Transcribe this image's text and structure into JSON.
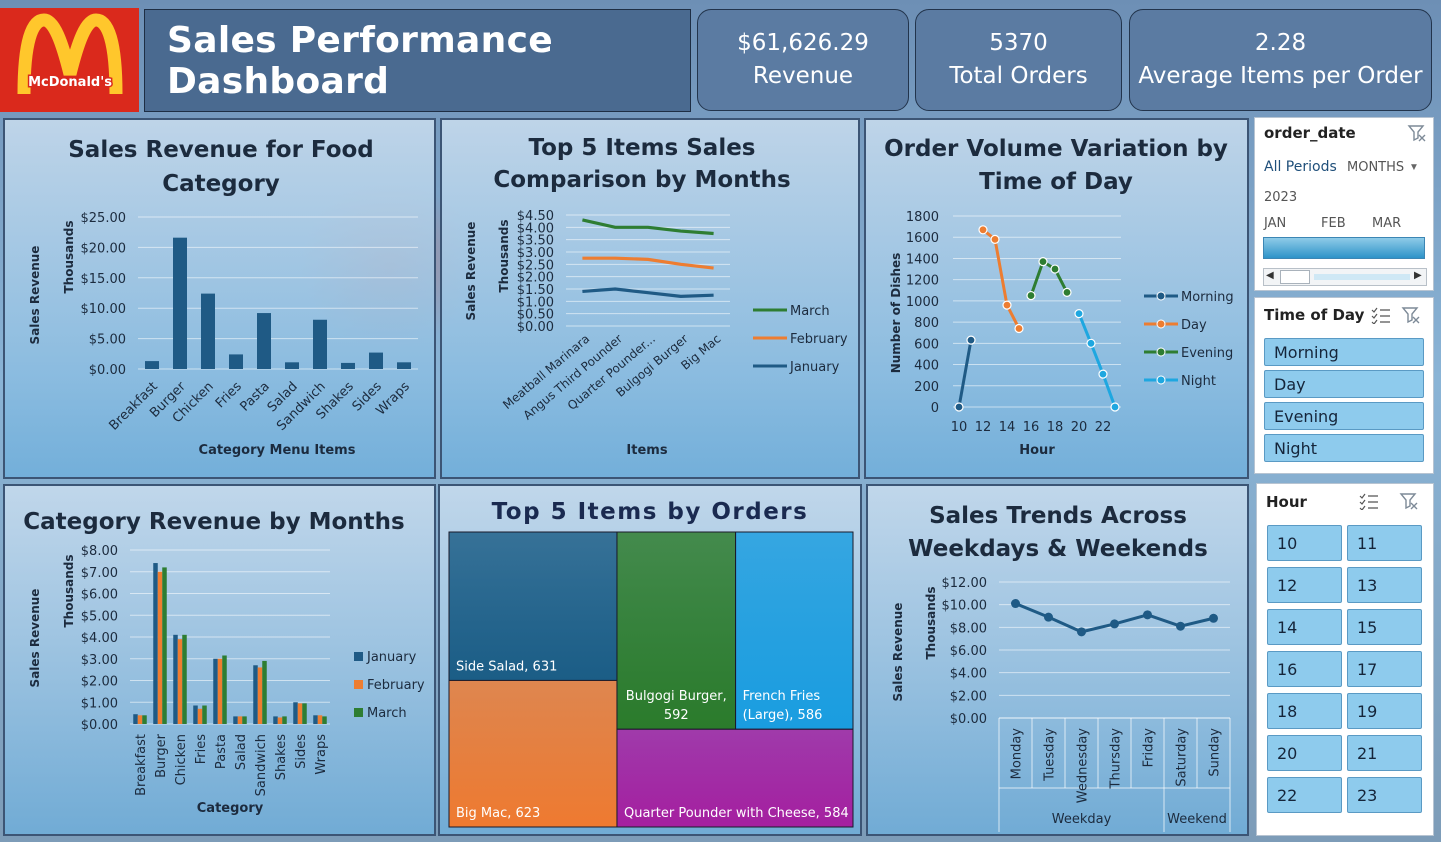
{
  "header": {
    "logo_text": "McDonald's",
    "title": "Sales Performance Dashboard",
    "kpis": [
      {
        "value": "$61,626.29",
        "label": "Revenue"
      },
      {
        "value": "5370",
        "label": "Total Orders"
      },
      {
        "value": "2.28",
        "label": "Average Items per Order"
      }
    ]
  },
  "colors": {
    "brand_red": "#da291c",
    "brand_yellow": "#ffc72c",
    "navy": "#1f5a85",
    "orange": "#ed7d31",
    "green": "#2e7d32",
    "light_blue": "#1ea7e0",
    "slicer_button": "#8ecbed"
  },
  "timeline": {
    "field": "order_date",
    "all_periods": "All Periods",
    "level": "MONTHS",
    "year": "2023",
    "months": [
      "JAN",
      "FEB",
      "MAR"
    ],
    "selected_months": [
      "JAN",
      "FEB",
      "MAR"
    ]
  },
  "time_of_day_slicer": {
    "title": "Time of Day",
    "items": [
      "Morning",
      "Day",
      "Evening",
      "Night"
    ]
  },
  "hour_slicer": {
    "title": "Hour",
    "items": [
      "10",
      "11",
      "12",
      "13",
      "14",
      "15",
      "16",
      "17",
      "18",
      "19",
      "20",
      "21",
      "22",
      "23"
    ]
  },
  "chart_data": [
    {
      "id": "category-revenue",
      "type": "bar",
      "title": "Sales Revenue for Food Category",
      "xlabel": "Category Menu Items",
      "ylabel": "Sales Revenue",
      "unit_label": "Thousands",
      "ylim": [
        0,
        25
      ],
      "yticks": [
        "$0.00",
        "$5.00",
        "$10.00",
        "$15.00",
        "$20.00",
        "$25.00"
      ],
      "categories": [
        "Breakfast",
        "Burger",
        "Chicken",
        "Fries",
        "Pasta",
        "Salad",
        "Sandwich",
        "Shakes",
        "Sides",
        "Wraps"
      ],
      "values": [
        1.3,
        21.6,
        12.4,
        2.4,
        9.2,
        1.1,
        8.1,
        1.0,
        2.7,
        1.1
      ],
      "color": "#1f5a85"
    },
    {
      "id": "top5-months",
      "type": "line",
      "title": "Top 5 Items Sales Comparison by Months",
      "xlabel": "Items",
      "ylabel": "Sales Revenue",
      "unit_label": "Thousands",
      "ylim": [
        0,
        4.5
      ],
      "yticks": [
        "$0.00",
        "$0.50",
        "$1.00",
        "$1.50",
        "$2.00",
        "$2.50",
        "$3.00",
        "$3.50",
        "$4.00",
        "$4.50"
      ],
      "categories": [
        "Meatball Marinara",
        "Angus Third Pounder",
        "Quarter Pounder...",
        "Bulgogi Burger",
        "Big Mac"
      ],
      "legend_position": "right",
      "series": [
        {
          "name": "March",
          "color": "#2e7d32",
          "values": [
            4.3,
            4.0,
            4.0,
            3.85,
            3.75
          ]
        },
        {
          "name": "February",
          "color": "#ed7d31",
          "values": [
            2.75,
            2.75,
            2.7,
            2.5,
            2.35
          ]
        },
        {
          "name": "January",
          "color": "#1f5a85",
          "values": [
            1.4,
            1.5,
            1.35,
            1.2,
            1.25
          ]
        }
      ]
    },
    {
      "id": "order-volume-hour",
      "type": "line",
      "title": "Order Volume Variation by Time of Day",
      "xlabel": "Hour",
      "ylabel": "Number of Dishes",
      "ylim": [
        0,
        1800
      ],
      "yticks": [
        "0",
        "200",
        "400",
        "600",
        "800",
        "1000",
        "1200",
        "1400",
        "1600",
        "1800"
      ],
      "xticks": [
        "10",
        "12",
        "14",
        "16",
        "18",
        "20",
        "22"
      ],
      "xlim": [
        10,
        23
      ],
      "legend_position": "right",
      "series": [
        {
          "name": "Morning",
          "color": "#1f5a85",
          "points": [
            [
              10,
              0
            ],
            [
              11,
              630
            ]
          ]
        },
        {
          "name": "Day",
          "color": "#ed7d31",
          "points": [
            [
              12,
              1670
            ],
            [
              13,
              1580
            ],
            [
              14,
              960
            ],
            [
              15,
              740
            ]
          ]
        },
        {
          "name": "Evening",
          "color": "#2e7d32",
          "points": [
            [
              16,
              1050
            ],
            [
              17,
              1370
            ],
            [
              18,
              1300
            ],
            [
              19,
              1080
            ]
          ]
        },
        {
          "name": "Night",
          "color": "#1ea7e0",
          "points": [
            [
              20,
              880
            ],
            [
              21,
              600
            ],
            [
              22,
              310
            ],
            [
              23,
              0
            ]
          ]
        }
      ]
    },
    {
      "id": "category-months",
      "type": "bar",
      "title": "Category Revenue by Months",
      "xlabel": "Category",
      "ylabel": "Sales Revenue",
      "unit_label": "Thousands",
      "ylim": [
        0,
        8
      ],
      "yticks": [
        "$0.00",
        "$1.00",
        "$2.00",
        "$3.00",
        "$4.00",
        "$5.00",
        "$6.00",
        "$7.00",
        "$8.00"
      ],
      "categories": [
        "Breakfast",
        "Burger",
        "Chicken",
        "Fries",
        "Pasta",
        "Salad",
        "Sandwich",
        "Shakes",
        "Sides",
        "Wraps"
      ],
      "legend_position": "right",
      "series": [
        {
          "name": "January",
          "color": "#1f5a85",
          "values": [
            0.45,
            7.4,
            4.1,
            0.85,
            3.0,
            0.35,
            2.7,
            0.35,
            1.0,
            0.4
          ]
        },
        {
          "name": "February",
          "color": "#ed7d31",
          "values": [
            0.4,
            7.0,
            3.9,
            0.7,
            3.0,
            0.35,
            2.6,
            0.3,
            0.95,
            0.4
          ]
        },
        {
          "name": "March",
          "color": "#2e7d32",
          "values": [
            0.4,
            7.2,
            4.1,
            0.85,
            3.15,
            0.35,
            2.9,
            0.35,
            0.95,
            0.35
          ]
        }
      ]
    },
    {
      "id": "top5-orders",
      "type": "treemap",
      "title": "Top 5 Items by Orders",
      "items": [
        {
          "name": "Side Salad",
          "value": 631,
          "label": "Side Salad, 631",
          "color": "#1b5d86"
        },
        {
          "name": "Big Mac",
          "value": 623,
          "label": "Big Mac, 623",
          "color": "#ef7a30"
        },
        {
          "name": "Bulgogi Burger",
          "value": 592,
          "label": "Bulgogi Burger, 592",
          "color": "#2b7b2b"
        },
        {
          "name": "French Fries (Large)",
          "value": 586,
          "label": "French Fries (Large), 586",
          "color": "#1a9de0"
        },
        {
          "name": "Quarter Pounder with Cheese",
          "value": 584,
          "label": "Quarter Pounder with Cheese, 584",
          "color": "#a51fa0"
        }
      ]
    },
    {
      "id": "weekday-trends",
      "type": "line",
      "title": "Sales Trends Across Weekdays & Weekends",
      "ylabel": "Sales Revenue",
      "unit_label": "Thousands",
      "ylim": [
        0,
        12
      ],
      "yticks": [
        "$0.00",
        "$2.00",
        "$4.00",
        "$6.00",
        "$8.00",
        "$10.00",
        "$12.00"
      ],
      "categories": [
        "Monday",
        "Tuesday",
        "Wednesday",
        "Thursday",
        "Friday",
        "Saturday",
        "Sunday"
      ],
      "groups": [
        {
          "name": "Weekday",
          "span": 5
        },
        {
          "name": "Weekend",
          "span": 2
        }
      ],
      "series": [
        {
          "color": "#1f5a85",
          "values": [
            10.1,
            8.9,
            7.6,
            8.3,
            9.1,
            8.1,
            8.8
          ]
        }
      ]
    }
  ]
}
